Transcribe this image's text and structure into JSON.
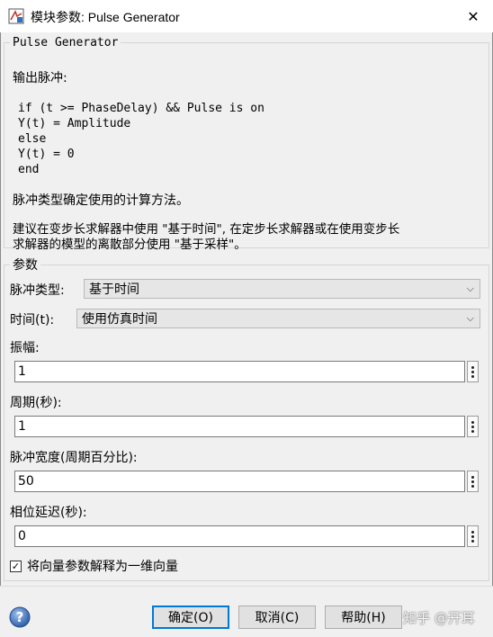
{
  "window": {
    "title": "模块参数: Pulse Generator",
    "close_glyph": "✕"
  },
  "description": {
    "legend": "Pulse Generator",
    "heading": "输出脉冲:",
    "code_lines": [
      "if (t >= PhaseDelay) && Pulse is on",
      "Y(t) = Amplitude",
      "else",
      "Y(t) = 0",
      "end"
    ],
    "para1": "脉冲类型确定使用的计算方法。",
    "para2_line1": "建议在变步长求解器中使用 \"基于时间\", 在定步长求解器或在使用变步长",
    "para2_line2": "求解器的模型的离散部分使用 \"基于采样\"。"
  },
  "params": {
    "legend": "参数",
    "pulse_type_label": "脉冲类型:",
    "pulse_type_value": "基于时间",
    "time_label": "时间(t):",
    "time_value": "使用仿真时间",
    "amplitude_label": "振幅:",
    "amplitude_value": "1",
    "period_label": "周期(秒):",
    "period_value": "1",
    "width_label": "脉冲宽度(周期百分比):",
    "width_value": "50",
    "phase_label": "相位延迟(秒):",
    "phase_value": "0",
    "vector_checkbox_label": "将向量参数解释为一维向量",
    "vector_checked": true,
    "check_glyph": "✓",
    "chevron_glyph": "⌵"
  },
  "buttons": {
    "ok": "确定(O)",
    "cancel": "取消(C)",
    "help": "帮助(H)"
  },
  "watermark": "知乎 @开耳",
  "colors": {
    "accent": "#0078d7",
    "help_icon": "#3a6fb5"
  }
}
